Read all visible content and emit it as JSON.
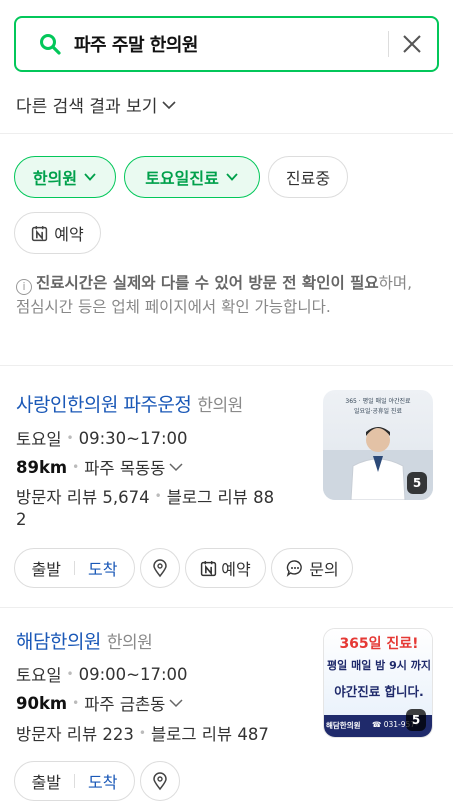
{
  "search": {
    "query": "파주 주말 한의원"
  },
  "other_results": "다른 검색 결과 보기",
  "filters": [
    {
      "label": "한의원",
      "active": true
    },
    {
      "label": "토요일진료",
      "active": true
    },
    {
      "label": "진료중",
      "active": false
    },
    {
      "label": "예약",
      "active": false
    }
  ],
  "notice": {
    "bold": "진료시간은 실제와 다를 수 있어 방문 전 확인이 필요",
    "rest": "하며, 점심시간 등은 업체 페이지에서 확인 가능합니다."
  },
  "places": [
    {
      "name": "사랑인한의원 파주운정",
      "category": "한의원",
      "day": "토요일",
      "hours": "09:30~17:00",
      "distance": "89km",
      "area": "파주 목동동",
      "visitor_reviews": "방문자 리뷰 5,674",
      "blog_reviews_1": "블로그 리뷰 88",
      "blog_reviews_2": "2",
      "image_count": "5",
      "thumb_text_1": "365 · 평일 매일 야간진료",
      "thumb_text_2": "일요일·공휴일 진료",
      "buttons": {
        "depart": "출발",
        "arrive": "도착",
        "reserve": "예약",
        "inquire": "문의"
      }
    },
    {
      "name": "해담한의원",
      "category": "한의원",
      "day": "토요일",
      "hours": "09:00~17:00",
      "distance": "90km",
      "area": "파주 금촌동",
      "visitor_reviews": "방문자 리뷰 223",
      "blog_reviews": "블로그 리뷰 487",
      "image_count": "5",
      "thumb_line1": "365일 진료!",
      "thumb_line2": "평일 매일 밤 9시 까지",
      "thumb_line3": "야간진료 합니다.",
      "thumb_footer_name": "해담한의원",
      "thumb_footer_phone": "☎ 031-957-",
      "buttons": {
        "depart": "출발",
        "arrive": "도착"
      }
    }
  ],
  "colors": {
    "accent": "#03c75a",
    "link": "#1a58b7"
  }
}
